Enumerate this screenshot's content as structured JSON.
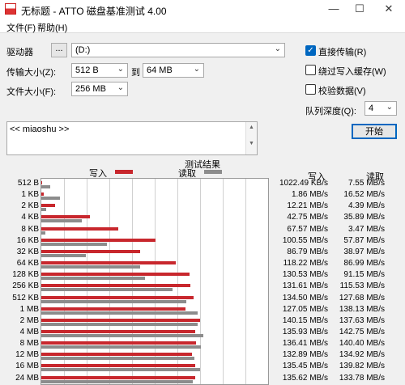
{
  "window": {
    "title": "无标题 - ATTO 磁盘基准测试 4.00",
    "min": "—",
    "max": "☐",
    "close": "✕"
  },
  "menu": {
    "file": "文件(F)",
    "help": "帮助(H)"
  },
  "drive": {
    "label": "驱动器",
    "browse": "...",
    "value": "(D:)"
  },
  "transfer": {
    "label": "传输大小(Z):",
    "from": "512 B",
    "to_label": "到",
    "to": "64 MB"
  },
  "filesize": {
    "label": "文件大小(F):",
    "value": "256 MB"
  },
  "options": {
    "direct_io": {
      "label": "直接传输(R)",
      "checked": true
    },
    "bypass_cache": {
      "label": "绕过写入缓存(W)",
      "checked": false
    },
    "verify": {
      "label": "校验数据(V)",
      "checked": false
    },
    "queue_label": "队列深度(Q):",
    "queue_value": "4",
    "start": "开始"
  },
  "notes": {
    "text": "<< miaoshu >>"
  },
  "results": {
    "title": "测试结果",
    "legend_write": "写入",
    "legend_read": "读取",
    "col_write": "写入",
    "col_read": "读取",
    "colors": {
      "write": "#c8272d",
      "read": "#8c8c8c"
    }
  },
  "chart_data": {
    "type": "bar",
    "title": "测试结果",
    "categories": [
      "512 B",
      "1 KB",
      "2 KB",
      "4 KB",
      "8 KB",
      "16 KB",
      "32 KB",
      "64 KB",
      "128 KB",
      "256 KB",
      "512 KB",
      "1 MB",
      "2 MB",
      "4 MB",
      "8 MB",
      "12 MB",
      "16 MB",
      "24 MB"
    ],
    "series": [
      {
        "name": "写入",
        "values": [
          1.02,
          1.86,
          12.21,
          42.75,
          67.57,
          100.55,
          86.79,
          118.22,
          130.53,
          131.61,
          134.5,
          127.05,
          140.15,
          135.93,
          136.41,
          132.89,
          135.45,
          135.62
        ]
      },
      {
        "name": "读取",
        "values": [
          7.55,
          16.52,
          4.39,
          35.89,
          3.47,
          57.87,
          38.97,
          86.99,
          91.15,
          115.53,
          127.68,
          138.13,
          137.63,
          142.75,
          140.4,
          134.92,
          139.82,
          133.78
        ]
      }
    ],
    "write_text": [
      "1022.49 KB/s",
      "1.86 MB/s",
      "12.21 MB/s",
      "42.75 MB/s",
      "67.57 MB/s",
      "100.55 MB/s",
      "86.79 MB/s",
      "118.22 MB/s",
      "130.53 MB/s",
      "131.61 MB/s",
      "134.50 MB/s",
      "127.05 MB/s",
      "140.15 MB/s",
      "135.93 MB/s",
      "136.41 MB/s",
      "132.89 MB/s",
      "135.45 MB/s",
      "135.62 MB/s"
    ],
    "read_text": [
      "7.55 MB/s",
      "16.52 MB/s",
      "4.39 MB/s",
      "35.89 MB/s",
      "3.47 MB/s",
      "57.87 MB/s",
      "38.97 MB/s",
      "86.99 MB/s",
      "91.15 MB/s",
      "115.53 MB/s",
      "127.68 MB/s",
      "138.13 MB/s",
      "137.63 MB/s",
      "142.75 MB/s",
      "140.40 MB/s",
      "134.92 MB/s",
      "139.82 MB/s",
      "133.78 MB/s"
    ],
    "xlim": [
      0,
      200
    ]
  }
}
